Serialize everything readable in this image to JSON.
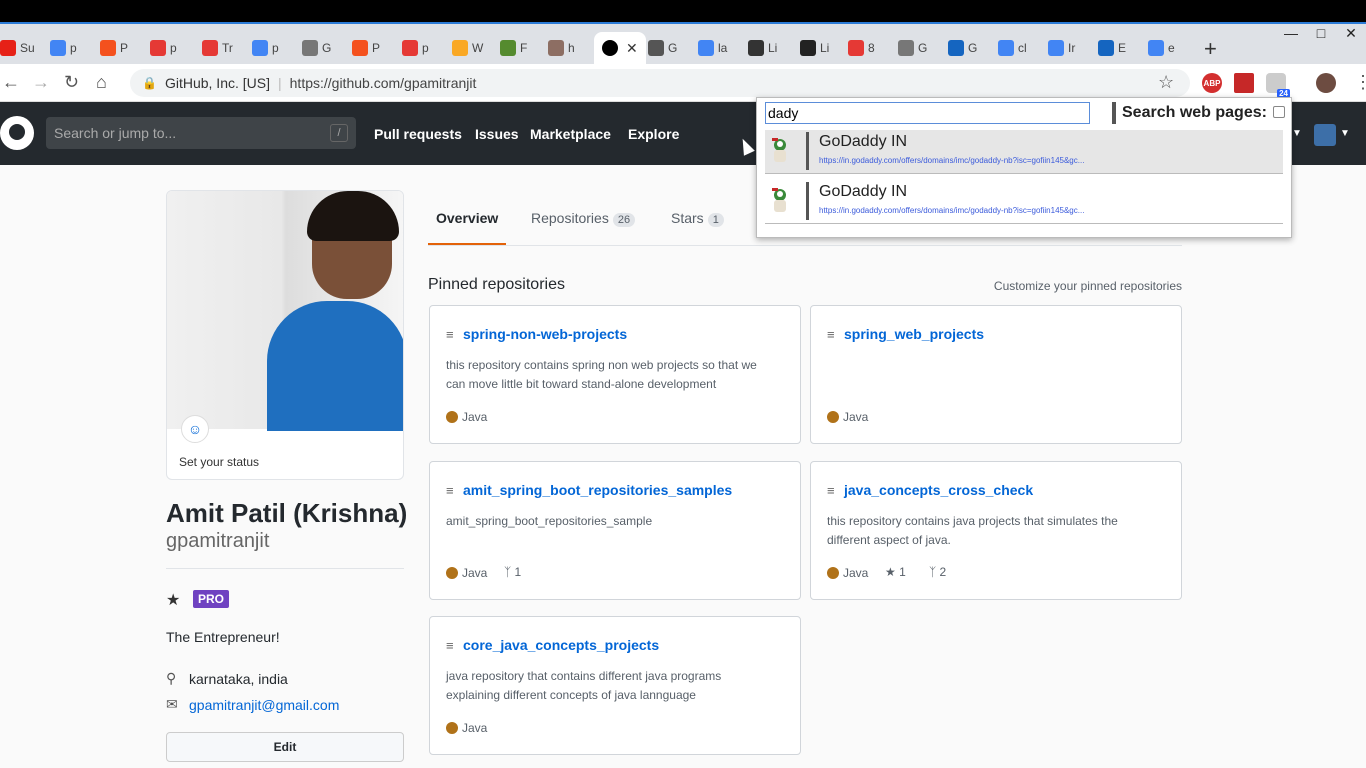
{
  "browser": {
    "tabs": [
      {
        "label": "Su",
        "color": "#e62117",
        "icon": "youtube-icon"
      },
      {
        "label": "p",
        "color": "#4285f4",
        "icon": "google-icon"
      },
      {
        "label": "P",
        "color": "#f4511e",
        "icon": "app-icon"
      },
      {
        "label": "p",
        "color": "#e53935",
        "icon": "power-icon"
      },
      {
        "label": "Tr",
        "color": "#e53935",
        "icon": "app-icon"
      },
      {
        "label": "p",
        "color": "#4285f4",
        "icon": "google-icon"
      },
      {
        "label": "G",
        "color": "#777",
        "icon": "app-icon"
      },
      {
        "label": "P",
        "color": "#f4511e",
        "icon": "app-icon"
      },
      {
        "label": "p",
        "color": "#e53935",
        "icon": "power-icon"
      },
      {
        "label": "W",
        "color": "#f9a825",
        "icon": "app-icon"
      },
      {
        "label": "F",
        "color": "#558b2f",
        "icon": "app-icon"
      },
      {
        "label": "h",
        "color": "#8d6e63",
        "icon": "app-icon"
      },
      {
        "label": "G",
        "color": "#555",
        "icon": "app-icon"
      },
      {
        "label": "la",
        "color": "#4285f4",
        "icon": "google-icon"
      },
      {
        "label": "Li",
        "color": "#333",
        "icon": "wikipedia-icon"
      },
      {
        "label": "Li",
        "color": "#222",
        "icon": "app-icon"
      },
      {
        "label": "8",
        "color": "#e53935",
        "icon": "app-icon"
      },
      {
        "label": "G",
        "color": "#777",
        "icon": "app-icon"
      },
      {
        "label": "G",
        "color": "#1565c0",
        "icon": "app-icon"
      },
      {
        "label": "cl",
        "color": "#4285f4",
        "icon": "google-icon"
      },
      {
        "label": "Ir",
        "color": "#4285f4",
        "icon": "google-icon"
      },
      {
        "label": "E",
        "color": "#1565c0",
        "icon": "puzzle-icon"
      },
      {
        "label": "e",
        "color": "#4285f4",
        "icon": "google-icon"
      }
    ],
    "active_tab_icon": "github-icon",
    "site_identity": "GitHub, Inc. [US]",
    "url": "https://github.com/gpamitranjit",
    "extension_badge": "24",
    "abp_label": "ABP"
  },
  "github": {
    "search_placeholder": "Search or jump to...",
    "search_key": "/",
    "nav": [
      "Pull requests",
      "Issues",
      "Marketplace",
      "Explore"
    ]
  },
  "profile": {
    "set_status": "Set your status",
    "full_name": "Amit Patil (Krishna)",
    "username": "gpamitranjit",
    "pro_badge": "PRO",
    "bio": "The Entrepreneur!",
    "location": "karnataka, india",
    "email": "gpamitranjit@gmail.com",
    "edit_label": "Edit"
  },
  "tabs": {
    "overview": "Overview",
    "repositories": "Repositories",
    "repositories_count": "26",
    "stars": "Stars",
    "stars_count": "1"
  },
  "pinned": {
    "title": "Pinned repositories",
    "customize": "Customize your pinned repositories",
    "language_color": "#b07219",
    "repos": [
      {
        "name": "spring-non-web-projects",
        "desc": "this repository contains spring non web projects so that we can move little bit toward stand-alone development",
        "lang": "Java"
      },
      {
        "name": "spring_web_projects",
        "desc": "",
        "lang": "Java"
      },
      {
        "name": "amit_spring_boot_repositories_samples",
        "desc": "amit_spring_boot_repositories_sample",
        "lang": "Java",
        "forks": "1"
      },
      {
        "name": "java_concepts_cross_check",
        "desc": "this repository contains java projects that simulates the different aspect of java.",
        "lang": "Java",
        "stars": "1",
        "forks": "2"
      },
      {
        "name": "core_java_concepts_projects",
        "desc": "java repository that contains different java programs explaining different concepts of java lannguage",
        "lang": "Java"
      }
    ]
  },
  "popup": {
    "input_value": "dady",
    "search_web_label": "Search web pages:",
    "results": [
      {
        "title": "GoDaddy IN",
        "url": "https://in.godaddy.com/offers/domains/imc/godaddy-nb?isc=gofiin145&gc..."
      },
      {
        "title": "GoDaddy IN",
        "url": "https://in.godaddy.com/offers/domains/imc/godaddy-nb?isc=gofiin145&gc..."
      }
    ]
  }
}
